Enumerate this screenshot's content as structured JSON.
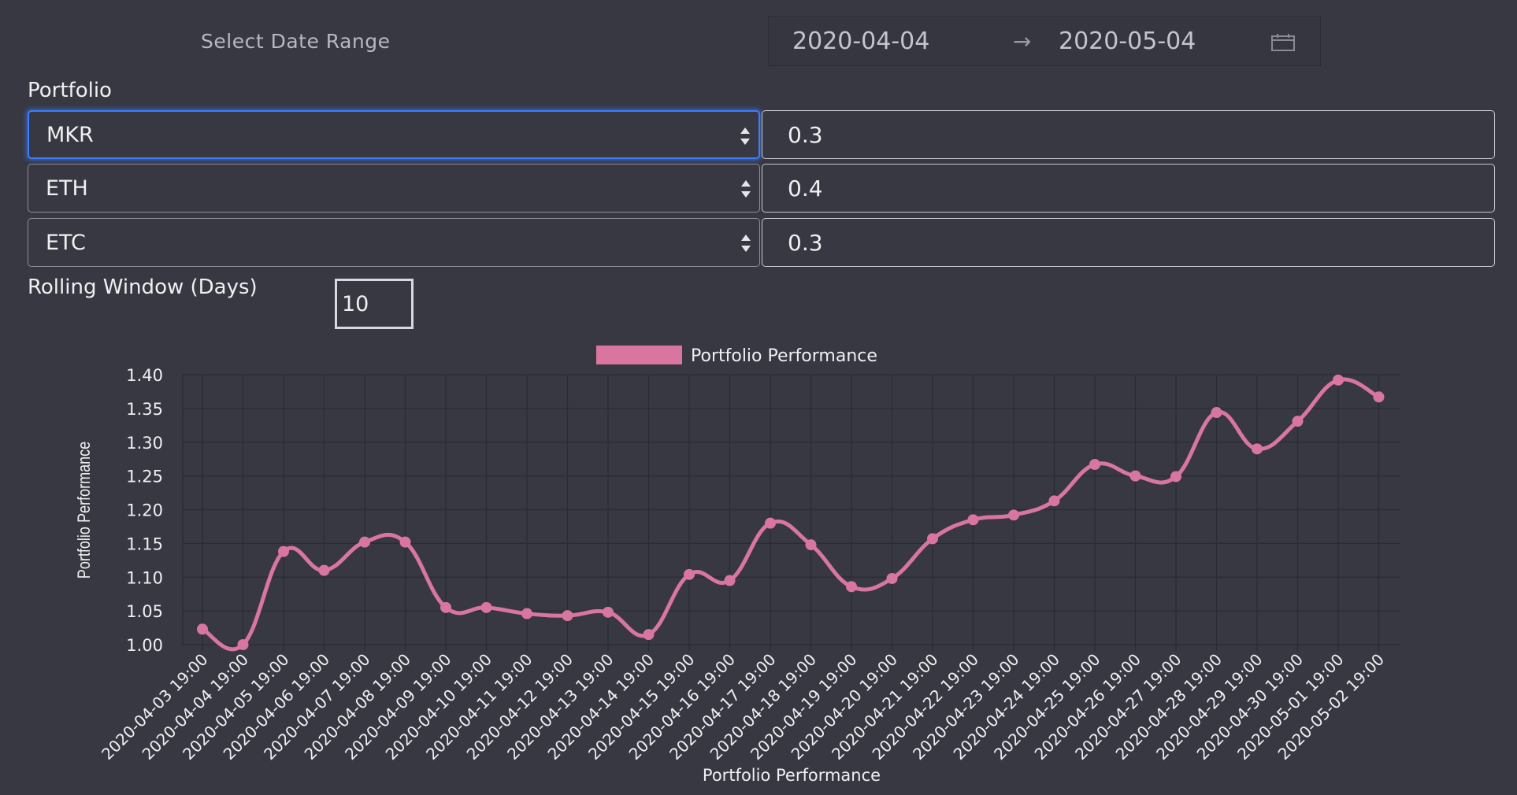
{
  "date_range": {
    "label": "Select Date Range",
    "start": "2020-04-04",
    "arrow": "→",
    "end": "2020-05-04"
  },
  "portfolio": {
    "title": "Portfolio",
    "rows": [
      {
        "asset": "MKR",
        "weight": "0.3"
      },
      {
        "asset": "ETH",
        "weight": "0.4"
      },
      {
        "asset": "ETC",
        "weight": "0.3"
      }
    ]
  },
  "rolling_window": {
    "label": "Rolling Window (Days)",
    "value": "10"
  },
  "chart_data": {
    "type": "line",
    "title": "",
    "xlabel": "Portfolio Performance",
    "ylabel": "Portfolio Performance",
    "legend": "top-center",
    "grid": true,
    "ylim": [
      1.0,
      1.4
    ],
    "yticks": [
      "1.00",
      "1.05",
      "1.10",
      "1.15",
      "1.20",
      "1.25",
      "1.30",
      "1.35",
      "1.40"
    ],
    "x": [
      "2020-04-03 19:00",
      "2020-04-04 19:00",
      "2020-04-05 19:00",
      "2020-04-06 19:00",
      "2020-04-07 19:00",
      "2020-04-08 19:00",
      "2020-04-09 19:00",
      "2020-04-10 19:00",
      "2020-04-11 19:00",
      "2020-04-12 19:00",
      "2020-04-13 19:00",
      "2020-04-14 19:00",
      "2020-04-15 19:00",
      "2020-04-16 19:00",
      "2020-04-17 19:00",
      "2020-04-18 19:00",
      "2020-04-19 19:00",
      "2020-04-20 19:00",
      "2020-04-21 19:00",
      "2020-04-22 19:00",
      "2020-04-23 19:00",
      "2020-04-24 19:00",
      "2020-04-25 19:00",
      "2020-04-26 19:00",
      "2020-04-27 19:00",
      "2020-04-28 19:00",
      "2020-04-29 19:00",
      "2020-04-30 19:00",
      "2020-05-01 19:00",
      "2020-05-02 19:00"
    ],
    "series": [
      {
        "name": "Portfolio Performance",
        "color": "#d9769f",
        "values": [
          1.023,
          1.0,
          1.138,
          1.11,
          1.152,
          1.152,
          1.055,
          1.055,
          1.046,
          1.043,
          1.048,
          1.015,
          1.104,
          1.095,
          1.18,
          1.148,
          1.086,
          1.098,
          1.157,
          1.185,
          1.192,
          1.213,
          1.267,
          1.25,
          1.249,
          1.344,
          1.29,
          1.331,
          1.392,
          1.367
        ]
      }
    ]
  }
}
